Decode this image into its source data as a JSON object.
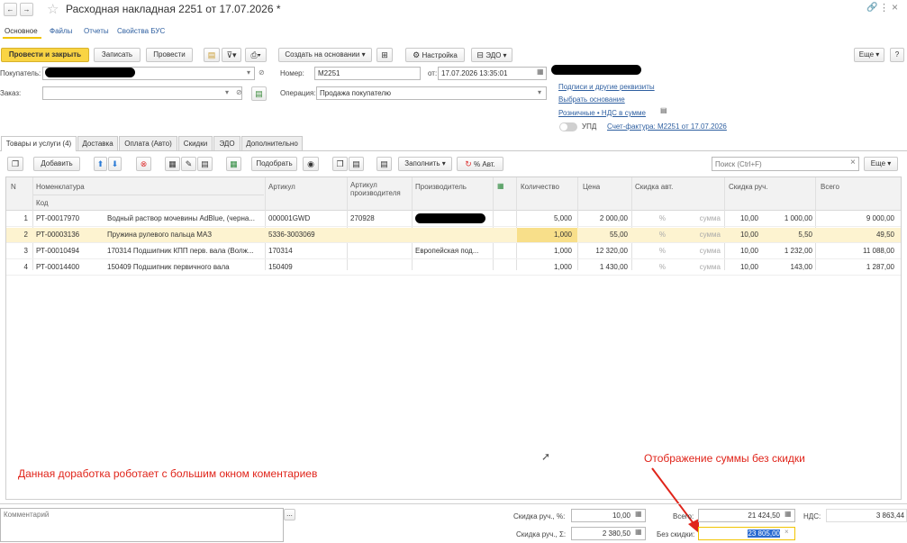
{
  "window": {
    "title": "Расходная накладная 2251 от 17.07.2026 *"
  },
  "nav_tabs": [
    "Основное",
    "Файлы",
    "Отчеты",
    "Свойства БУС"
  ],
  "toolbar": {
    "post_close": "Провести и закрыть",
    "save": "Записать",
    "post": "Провести",
    "create_based": "Создать на основании",
    "settings": "Настройка",
    "edo": "ЭДО",
    "more": "Еще",
    "help": "?"
  },
  "header": {
    "buyer_label": "Покупатель:",
    "order_label": "Заказ:",
    "number_label": "Номер:",
    "number_value": "М2251",
    "date_label": "от:",
    "date_value": "17.07.2026 13:35:01",
    "operation_label": "Операция:",
    "operation_value": "Продажа покупателю",
    "links": {
      "signatures": "Подписи и другие реквизиты",
      "select_basis": "Выбрать основание",
      "vat_retail": "Розничные • НДС в сумме",
      "upd": "УПД",
      "invoice": "Счет-фактура: М2251 от 17.07.2026"
    }
  },
  "section_tabs": [
    "Товары и услуги (4)",
    "Доставка",
    "Оплата (Авто)",
    "Скидки",
    "ЭДО",
    "Дополнительно"
  ],
  "table_toolbar": {
    "add": "Добавить",
    "pick": "Подобрать",
    "fill": "Заполнить",
    "auto_pct": "% Авт.",
    "search_placeholder": "Поиск (Ctrl+F)",
    "more": "Еще"
  },
  "table": {
    "headers": {
      "n": "N",
      "nomenclature": "Номенклатура",
      "code": "Код",
      "article": "Артикул",
      "maker_article": "Артикул производителя",
      "maker": "Производитель",
      "qty": "Количество",
      "price": "Цена",
      "auto_discount": "Скидка авт.",
      "manual_discount": "Скидка руч.",
      "total": "Всего"
    },
    "rows": [
      {
        "n": "1",
        "code": "РТ-00017970",
        "name": "Водный раствор мочевины AdBlue, (черна...",
        "article": "000001GWD",
        "maker_article": "270928",
        "maker": "",
        "qty": "5,000",
        "price": "2 000,00",
        "auto_pct": "%",
        "auto_sum": "сумма",
        "manual_pct": "10,00",
        "manual_sum": "1 000,00",
        "total": "9 000,00"
      },
      {
        "n": "2",
        "code": "РТ-00003136",
        "name": "Пружина рулевого пальца МАЗ",
        "article": "5336-3003069",
        "maker_article": "",
        "maker": "",
        "qty": "1,000",
        "price": "55,00",
        "auto_pct": "%",
        "auto_sum": "сумма",
        "manual_pct": "10,00",
        "manual_sum": "5,50",
        "total": "49,50"
      },
      {
        "n": "3",
        "code": "РТ-00010494",
        "name": "170314 Подшипник КПП перв. вала (Волж...",
        "article": "170314",
        "maker_article": "",
        "maker": "Европейская под...",
        "qty": "1,000",
        "price": "12 320,00",
        "auto_pct": "%",
        "auto_sum": "сумма",
        "manual_pct": "10,00",
        "manual_sum": "1 232,00",
        "total": "11 088,00"
      },
      {
        "n": "4",
        "code": "РТ-00014400",
        "name": "150409 Подшипник первичного вала",
        "article": "150409",
        "maker_article": "",
        "maker": "",
        "qty": "1,000",
        "price": "1 430,00",
        "auto_pct": "%",
        "auto_sum": "сумма",
        "manual_pct": "10,00",
        "manual_sum": "143,00",
        "total": "1 287,00"
      }
    ]
  },
  "annotations": {
    "left": "Данная доработка роботает с большим окном коментариев",
    "right": "Отображение суммы без скидки"
  },
  "footer": {
    "comment_placeholder": "Комментарий",
    "manual_pct_label": "Скидка руч., %:",
    "manual_pct_value": "10,00",
    "manual_sum_label": "Скидка руч., Σ:",
    "manual_sum_value": "2 380,50",
    "total_label": "Всего:",
    "total_value": "21 424,50",
    "no_discount_label": "Без скидки:",
    "no_discount_value": "23 805,00",
    "vat_label": "НДС:",
    "vat_value": "3 863,44"
  },
  "colors": {
    "accent": "#f9d443",
    "selected_row": "#fdf3d0",
    "link": "#2e5fa0",
    "annotation": "#e0241a"
  }
}
